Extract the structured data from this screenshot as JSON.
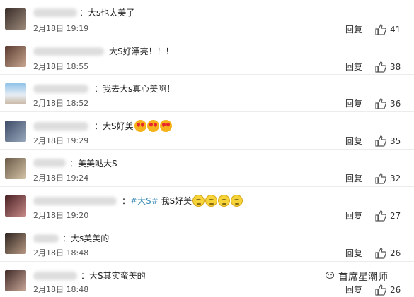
{
  "comments": [
    {
      "text": "：大s也太美了",
      "time": "2月18日 19:19",
      "reply": "回复",
      "likes": "41"
    },
    {
      "text": "大S好漂亮！！！",
      "time": "2月18日 18:55",
      "reply": "回复",
      "likes": "38"
    },
    {
      "text": "：我去大s真心美啊！",
      "time": "2月18日 18:52",
      "reply": "回复",
      "likes": "36"
    },
    {
      "text": "：大S好美",
      "time": "2月18日 19:29",
      "reply": "回复",
      "likes": "35",
      "emoji": "heart-eyes-emoji x3"
    },
    {
      "text": "：美美哒大S",
      "time": "2月18日 19:24",
      "reply": "回复",
      "likes": "32"
    },
    {
      "prefix": "：",
      "tag": "#大S#",
      "text": " 我S好美",
      "time": "2月18日 19:20",
      "reply": "回复",
      "likes": "27",
      "emoji": "eye-roll-emoji x4"
    },
    {
      "text": "：大s美美的",
      "time": "2月18日 18:48",
      "reply": "回复",
      "likes": "26"
    },
    {
      "text": "：大S其实蛮美的",
      "time": "2月18日 18:48",
      "reply": "回复",
      "likes": "26"
    }
  ],
  "watermark": "首席星潮师",
  "colors": {
    "link": "#3f8fb8",
    "separator": "#ececec",
    "text": "#333333"
  }
}
